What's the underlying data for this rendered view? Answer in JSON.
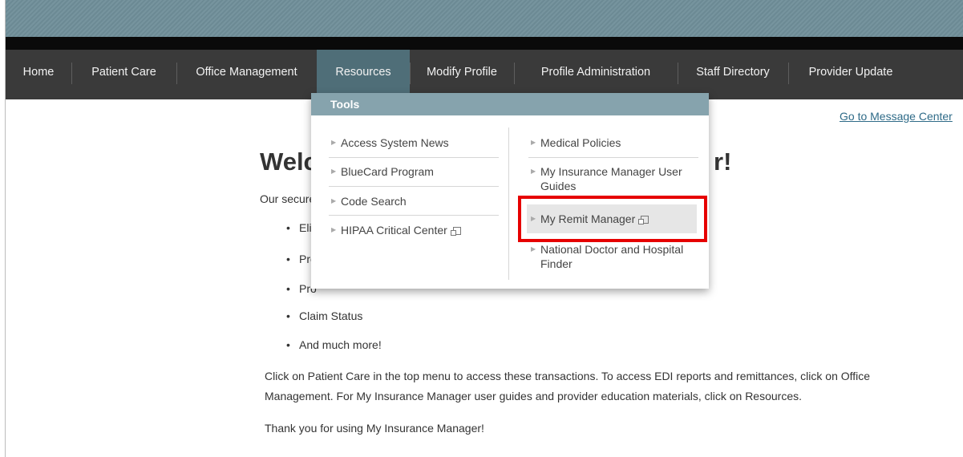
{
  "nav": {
    "items": [
      {
        "label": "Home"
      },
      {
        "label": "Patient Care"
      },
      {
        "label": "Office Management"
      },
      {
        "label": "Resources"
      },
      {
        "label": "Modify Profile"
      },
      {
        "label": "Profile Administration"
      },
      {
        "label": "Staff Directory"
      },
      {
        "label": "Provider Update"
      }
    ],
    "active": "Resources"
  },
  "dropdown": {
    "header": "Tools",
    "left_column": [
      {
        "label": "Access System News",
        "external": false
      },
      {
        "label": "BlueCard Program",
        "external": false
      },
      {
        "label": "Code Search",
        "external": false
      },
      {
        "label": "HIPAA Critical Center",
        "external": true
      }
    ],
    "right_column": [
      {
        "label": "Medical Policies",
        "external": false
      },
      {
        "label": "My Insurance Manager User Guides",
        "label_line1": "My Insurance Manager User",
        "label_line2": "Guides",
        "external": false
      },
      {
        "label": "My Remit Manager",
        "external": true,
        "highlighted": true
      },
      {
        "label": "National Doctor and Hospital Finder",
        "label_line1": "National Doctor and Hospital",
        "label_line2": "Finder",
        "external": false
      }
    ]
  },
  "links": {
    "message_center": "Go to Message Center"
  },
  "main": {
    "welcome_visible_start": "Welc",
    "welcome_visible_end": "r!",
    "intro_visible": "Our secure",
    "bullets_visible": [
      "Elig",
      "Pre",
      "Pro",
      "Claim Status",
      "And much more!"
    ],
    "paragraph1_line1": "Click on Patient Care in the top menu to access these transactions. To access EDI reports and remittances, click on Office",
    "paragraph1_line2": "Management. For My Insurance Manager user guides and provider education materials, click on Resources.",
    "thanks": "Thank you for using My Insurance Manager!"
  },
  "colors": {
    "banner": "#6f8e99",
    "navbar": "#3a3a3a",
    "active_tab": "#4f6e78",
    "dropdown_header": "#86a3ad",
    "highlight_box": "#e60000",
    "link": "#2f6b88"
  }
}
